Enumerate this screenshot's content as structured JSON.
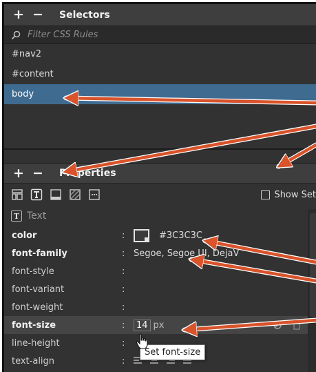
{
  "selectors": {
    "title": "Selectors",
    "add_label": "+",
    "remove_label": "−",
    "filter_placeholder": "Filter CSS Rules",
    "items": [
      {
        "label": "#nav2"
      },
      {
        "label": "#content"
      },
      {
        "label": "body",
        "selected": true
      }
    ]
  },
  "properties": {
    "title": "Properties",
    "add_label": "+",
    "remove_label": "−",
    "categories": [
      "layout-icon",
      "text-icon",
      "border-icon",
      "background-icon",
      "more-icon"
    ],
    "show_set_label": "Show Set",
    "show_set_checked": false,
    "section_label": "Text",
    "rows": [
      {
        "name": "color",
        "colon": ":",
        "value": "#3C3C3C"
      },
      {
        "name": "font-family",
        "colon": ":",
        "value": "Segoe, Segoe UI, DejaV"
      },
      {
        "name": "font-style",
        "colon": ":",
        "value": ""
      },
      {
        "name": "font-variant",
        "colon": ":",
        "value": ""
      },
      {
        "name": "font-weight",
        "colon": ":",
        "value": ""
      },
      {
        "name": "font-size",
        "colon": ":",
        "value": "14",
        "unit": "px"
      },
      {
        "name": "line-height",
        "colon": ":",
        "value": ""
      },
      {
        "name": "text-align",
        "colon": ":",
        "value": ""
      }
    ],
    "tooltip": "Set font-size"
  },
  "colors": {
    "accent_selection": "#3F6B90",
    "arrow": "#D9532B",
    "swatch": "#3C3C3C"
  }
}
